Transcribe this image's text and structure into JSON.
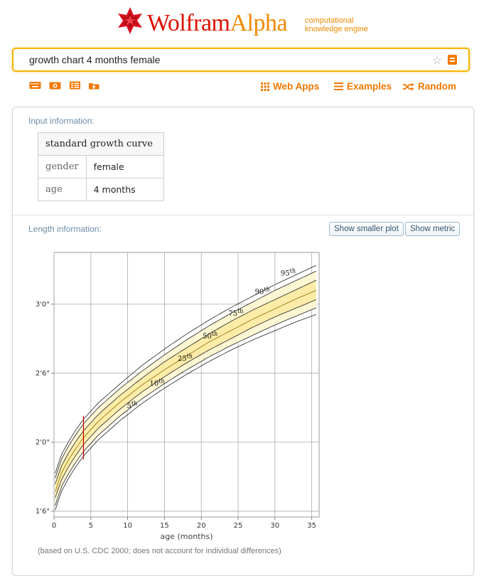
{
  "logo": {
    "wolfram": "Wolfram",
    "alpha": "Alpha",
    "tagline_line1": "computational",
    "tagline_line2": "knowledge engine"
  },
  "search": {
    "value": "growth chart 4 months female"
  },
  "nav": {
    "web_apps": "Web Apps",
    "examples": "Examples",
    "random": "Random"
  },
  "input_pod": {
    "title": "Input information:",
    "header": "standard growth curve",
    "rows": [
      {
        "label": "gender",
        "value": "female"
      },
      {
        "label": "age",
        "value": "4 months"
      }
    ]
  },
  "length_pod": {
    "title": "Length information:",
    "smaller_plot": "Show smaller plot",
    "metric": "Show metric",
    "footnote": "(based on U.S. CDC 2000; does not account for individual differences)"
  },
  "chart_data": {
    "type": "line",
    "xlabel": "age (months)",
    "ylabel": "",
    "xlim": [
      0,
      36
    ],
    "ylim": [
      17.5,
      40.5
    ],
    "x_ticks": [
      0,
      5,
      10,
      15,
      20,
      25,
      30,
      35
    ],
    "y_ticks": [
      {
        "value": 18,
        "label": "1'6\""
      },
      {
        "value": 24,
        "label": "2'0\""
      },
      {
        "value": 30,
        "label": "2'6\""
      },
      {
        "value": 36,
        "label": "3'0\""
      }
    ],
    "grid": true,
    "x": [
      0,
      1,
      2,
      3,
      4,
      6,
      9,
      12,
      15,
      18,
      21,
      24,
      27,
      30,
      33,
      36
    ],
    "series": [
      {
        "name": "5th",
        "label": "5",
        "values": [
          17.8,
          19.7,
          20.9,
          21.9,
          22.8,
          24.2,
          25.9,
          27.4,
          28.7,
          29.9,
          31.0,
          32.0,
          32.9,
          33.7,
          34.5,
          35.2
        ]
      },
      {
        "name": "10th",
        "label": "10",
        "values": [
          18.2,
          20.1,
          21.3,
          22.3,
          23.2,
          24.6,
          26.3,
          27.8,
          29.1,
          30.3,
          31.4,
          32.4,
          33.3,
          34.2,
          35.0,
          35.8
        ]
      },
      {
        "name": "25th",
        "label": "25",
        "values": [
          18.9,
          20.7,
          21.9,
          22.9,
          23.8,
          25.2,
          26.9,
          28.4,
          29.7,
          30.9,
          32.0,
          33.0,
          34.0,
          34.9,
          35.7,
          36.5
        ]
      },
      {
        "name": "50th",
        "label": "50",
        "values": [
          19.4,
          21.3,
          22.5,
          23.5,
          24.4,
          25.8,
          27.5,
          29.0,
          30.3,
          31.5,
          32.7,
          33.7,
          34.7,
          35.6,
          36.5,
          37.3
        ]
      },
      {
        "name": "75th",
        "label": "75",
        "values": [
          20.1,
          21.9,
          23.1,
          24.1,
          25.0,
          26.4,
          28.1,
          29.6,
          31.0,
          32.2,
          33.4,
          34.5,
          35.5,
          36.4,
          37.3,
          38.2
        ]
      },
      {
        "name": "90th",
        "label": "90",
        "values": [
          20.6,
          22.5,
          23.7,
          24.7,
          25.6,
          27.0,
          28.7,
          30.2,
          31.6,
          32.9,
          34.1,
          35.2,
          36.2,
          37.2,
          38.1,
          39.0
        ]
      },
      {
        "name": "95th",
        "label": "95",
        "values": [
          21.0,
          22.9,
          24.1,
          25.1,
          26.0,
          27.4,
          29.1,
          30.7,
          32.1,
          33.4,
          34.6,
          35.7,
          36.7,
          37.7,
          38.6,
          39.5
        ]
      }
    ],
    "marker": {
      "x": 4,
      "y_range": [
        22.5,
        26.3
      ],
      "color": "#cc0000"
    },
    "colors": {
      "band_outer": "#fdf6d3",
      "band_inner": "#fbe89a",
      "line": "#222222"
    }
  }
}
